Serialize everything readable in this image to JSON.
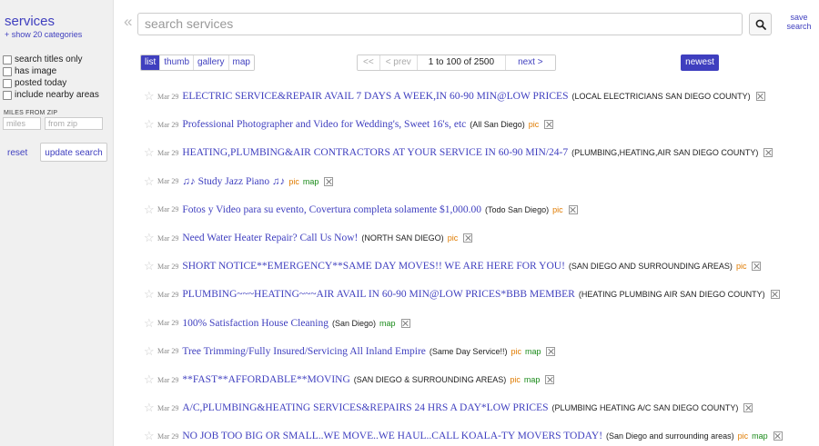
{
  "sidebar": {
    "category_title": "services",
    "show_categories": "+ show 20 categories",
    "filters": [
      "search titles only",
      "has image",
      "posted today",
      "include nearby areas"
    ],
    "miles_from_zip_label": "MILES FROM ZIP",
    "miles_placeholder": "miles",
    "zip_placeholder": "from zip",
    "reset_label": "reset",
    "update_label": "update search"
  },
  "topbar": {
    "collapse_glyph": "«",
    "search_placeholder": "search services",
    "save_search_label": "save search"
  },
  "view_tabs": [
    "list",
    "thumb",
    "gallery",
    "map"
  ],
  "active_view": "list",
  "pager": {
    "first": "<<",
    "prev": "< prev",
    "range": "1 to 100 of 2500",
    "next": "next >"
  },
  "sort_label": "newest",
  "colors": {
    "link": "#3f3fbf",
    "pic_tag": "#e07b00",
    "map_tag": "#198a19",
    "sidebar_bg": "#f0f0f0"
  },
  "listings": [
    {
      "date": "Mar 29",
      "title": "ELECTRIC SERVICE&REPAIR AVAIL 7 DAYS A WEEK,IN 60-90 MIN@LOW PRICES",
      "location": "(LOCAL ELECTRICIANS SAN DIEGO COUNTY)",
      "pic": "",
      "map": ""
    },
    {
      "date": "Mar 29",
      "title": "Professional Photographer and Video for Wedding's, Sweet 16's, etc",
      "location": "(All San Diego)",
      "pic": "pic",
      "map": ""
    },
    {
      "date": "Mar 29",
      "title": "HEATING,PLUMBING&AIR CONTRACTORS AT YOUR SERVICE IN 60-90 MIN/24-7",
      "location": "(PLUMBING,HEATING,AIR SAN DIEGO COUNTY)",
      "pic": "",
      "map": ""
    },
    {
      "date": "Mar 29",
      "title": "♫♪ Study Jazz Piano ♫♪",
      "location": "",
      "pic": "pic",
      "map": "map"
    },
    {
      "date": "Mar 29",
      "title": "Fotos y Video para su evento, Covertura completa solamente $1,000.00",
      "location": "(Todo San Diego)",
      "pic": "pic",
      "map": ""
    },
    {
      "date": "Mar 29",
      "title": "Need Water Heater Repair? Call Us Now!",
      "location": "(NORTH SAN DIEGO)",
      "pic": "pic",
      "map": ""
    },
    {
      "date": "Mar 29",
      "title": "SHORT NOTICE**EMERGENCY**SAME DAY MOVES!! WE ARE HERE FOR YOU!",
      "location": "(SAN DIEGO AND SURROUNDING AREAS)",
      "pic": "pic",
      "map": ""
    },
    {
      "date": "Mar 29",
      "title": "PLUMBING~~~HEATING~~~AIR AVAIL IN 60-90 MIN@LOW PRICES*BBB MEMBER",
      "location": "(HEATING PLUMBING AIR SAN DIEGO COUNTY)",
      "pic": "",
      "map": ""
    },
    {
      "date": "Mar 29",
      "title": "100% Satisfaction House Cleaning",
      "location": "(San Diego)",
      "pic": "",
      "map": "map"
    },
    {
      "date": "Mar 29",
      "title": "Tree Trimming/Fully Insured/Servicing All Inland Empire",
      "location": "(Same Day Service!!)",
      "pic": "pic",
      "map": "map"
    },
    {
      "date": "Mar 29",
      "title": "**FAST**AFFORDABLE**MOVING",
      "location": "(SAN DIEGO & SURROUNDING AREAS)",
      "pic": "pic",
      "map": "map"
    },
    {
      "date": "Mar 29",
      "title": "A/C,PLUMBING&HEATING SERVICES&REPAIRS 24 HRS A DAY*LOW PRICES",
      "location": "(PLUMBING HEATING A/C SAN DIEGO COUNTY)",
      "pic": "",
      "map": ""
    },
    {
      "date": "Mar 29",
      "title": "NO JOB TOO BIG OR SMALL..WE MOVE..WE HAUL..CALL KOALA-TY MOVERS TODAY!",
      "location": "(San Diego and surrounding areas)",
      "pic": "pic",
      "map": "map"
    }
  ]
}
